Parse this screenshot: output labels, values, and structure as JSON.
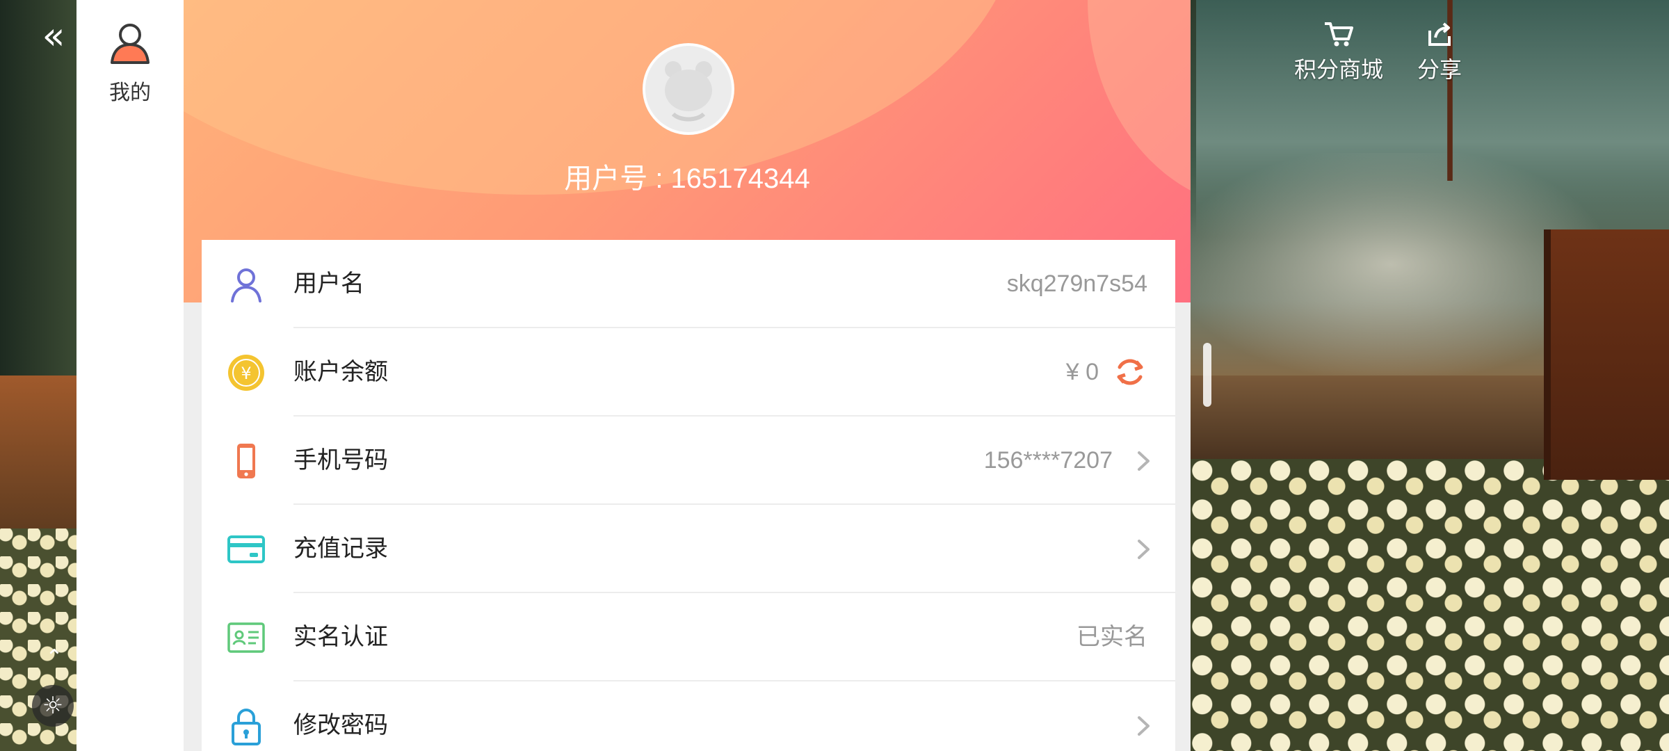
{
  "overlay": {
    "back_icon": "double-chevron-left-icon",
    "collapse_icon": "chevron-up-icon",
    "weather_icon": "sun-cloud-icon",
    "mall": {
      "icon": "cart-icon",
      "label": "积分商城"
    },
    "share": {
      "icon": "share-icon",
      "label": "分享"
    }
  },
  "side_nav": {
    "items": [
      {
        "icon": "user-icon",
        "label": "我的"
      }
    ]
  },
  "profile": {
    "avatar_icon": "default-avatar-icon",
    "user_id_text": "用户号 : 165174344"
  },
  "rows": [
    {
      "icon": "person-icon",
      "label": "用户名",
      "value": "skq279n7s54",
      "action": "none"
    },
    {
      "icon": "yen-coin-icon",
      "label": "账户余额",
      "value": "¥ 0",
      "action": "refresh"
    },
    {
      "icon": "phone-icon",
      "label": "手机号码",
      "value": "156****7207",
      "action": "chevron"
    },
    {
      "icon": "card-icon",
      "label": "充值记录",
      "value": "",
      "action": "chevron"
    },
    {
      "icon": "id-card-icon",
      "label": "实名认证",
      "value": "已实名",
      "action": "none"
    },
    {
      "icon": "lock-icon",
      "label": "修改密码",
      "value": "",
      "action": "chevron"
    }
  ],
  "colors": {
    "header_start": "#ffb27a",
    "header_end": "#ff6f80",
    "person_icon": "#6f72d8",
    "coin_icon": "#f4c430",
    "phone_icon": "#f07850",
    "card_icon": "#2ec6c6",
    "id_card_icon": "#5fc97a",
    "lock_icon": "#2aa0d8",
    "refresh_icon": "#f07048"
  }
}
